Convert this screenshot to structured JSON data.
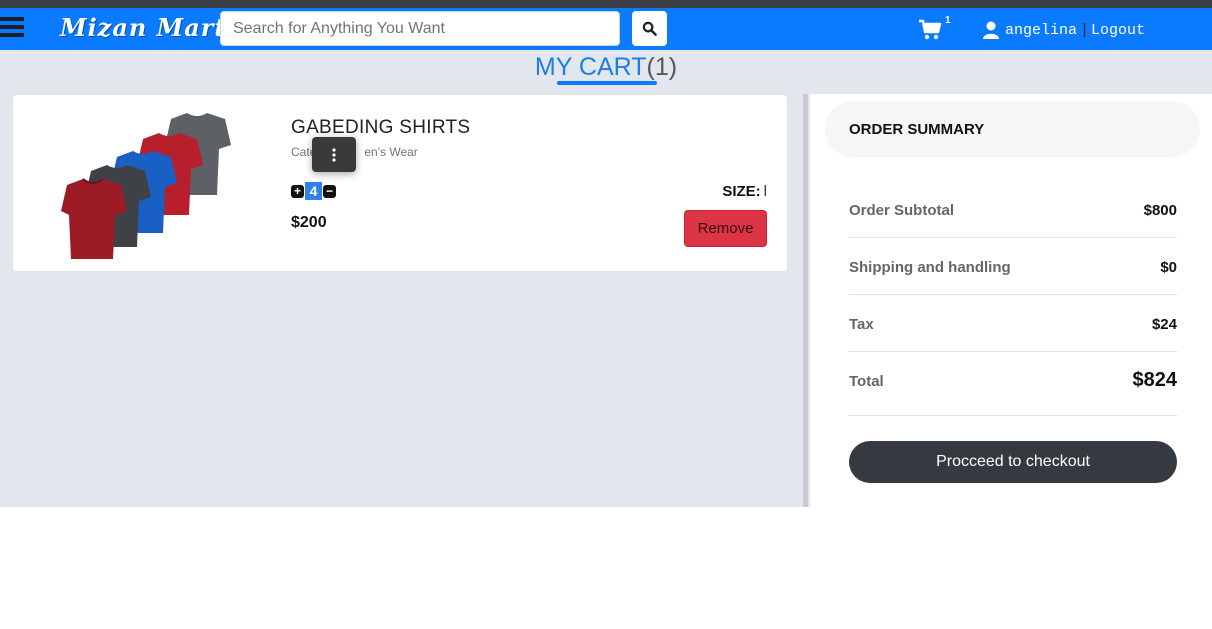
{
  "brand": {
    "name": "Mizan Mart"
  },
  "search": {
    "placeholder": "Search for Anything You Want"
  },
  "nav": {
    "cart_count": "1",
    "username": "angelina",
    "separator": "|",
    "logout_label": "Logout"
  },
  "page": {
    "title": "MY CART",
    "count": "(1)"
  },
  "cart_items": [
    {
      "name": "GABEDING SHIRTS",
      "category_prefix": "Cate",
      "category_suffix": "en's Wear",
      "quantity": "4",
      "price": "$200",
      "size_label": "SIZE:",
      "size_value": "l",
      "remove_label": "Remove"
    }
  ],
  "summary": {
    "title": "ORDER SUMMARY",
    "subtotal_label": "Order Subtotal",
    "subtotal_value": "$800",
    "shipping_label": "Shipping and handling",
    "shipping_value": "$0",
    "tax_label": "Tax",
    "tax_value": "$24",
    "total_label": "Total",
    "total_value": "$824",
    "checkout_label": "Procceed to checkout"
  },
  "colors": {
    "navbar": "#0a7bff",
    "page_bg": "#e2e7ee",
    "remove": "#dc3545",
    "checkout": "#343a40",
    "title": "#1b7fe6"
  },
  "icons": [
    "menu-icon",
    "search-icon",
    "cart-icon",
    "user-icon",
    "kebab-menu-icon",
    "plus-icon",
    "minus-icon"
  ]
}
